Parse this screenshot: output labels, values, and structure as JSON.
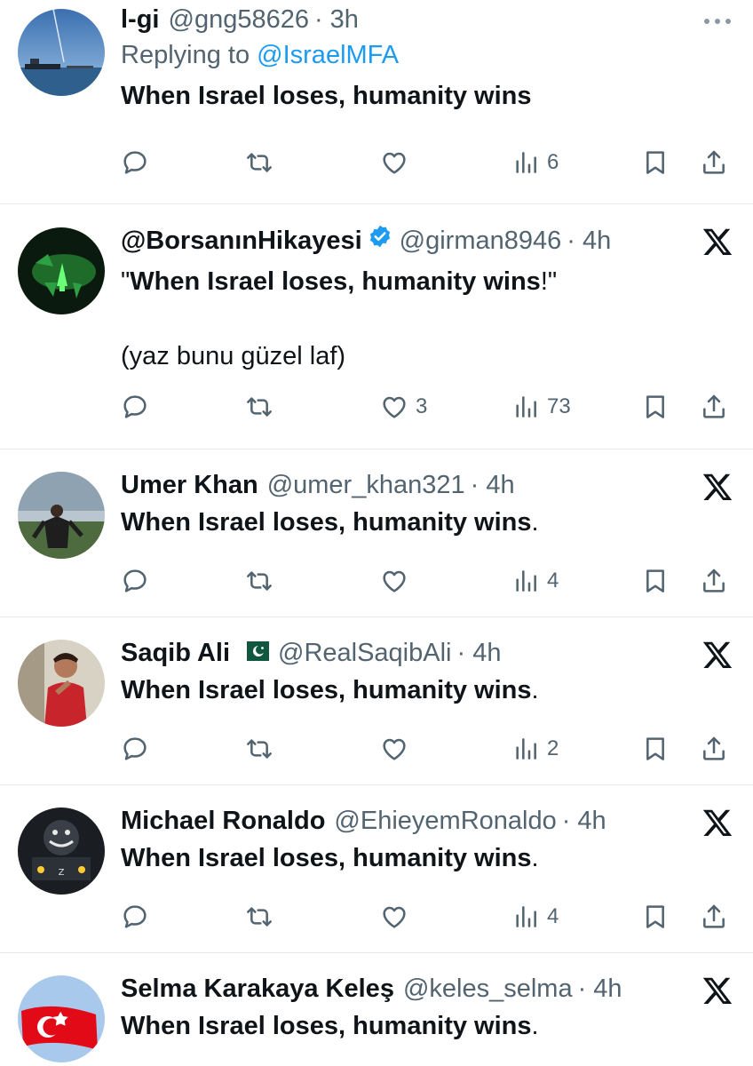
{
  "tweets": [
    {
      "name": "l-gi",
      "handle": "@gng58626",
      "time": "· 3h",
      "replying_prefix": "Replying to",
      "replying_to": "@IsraelMFA",
      "text": "When Israel loses, humanity wins",
      "top_icon": "more-icon",
      "reply_count": "",
      "retweet_count": "",
      "like_count": "",
      "views": "6"
    },
    {
      "name": "@BorsanınHikayesi",
      "handle": "@girman8946",
      "time": "· 4h",
      "verified": true,
      "text_bold": "When Israel loses, humanity wins",
      "text_tail": "!\"",
      "text_head": "\"",
      "text_extra": "(yaz bunu güzel laf)",
      "top_icon": "x-logo-icon",
      "like_count": "3",
      "views": "73"
    },
    {
      "name": "Umer Khan",
      "handle": "@umer_khan321",
      "time": "· 4h",
      "text_bold": "When Israel loses, humanity wins",
      "text_tail": ".",
      "top_icon": "x-logo-icon",
      "views": "4"
    },
    {
      "name": "Saqib Ali",
      "flag": "pakistan-flag",
      "handle": "@RealSaqibAli",
      "time": "· 4h",
      "text_bold": "When Israel loses, humanity wins",
      "text_tail": ".",
      "top_icon": "x-logo-icon",
      "views": "2"
    },
    {
      "name": "Michael Ronaldo",
      "handle": "@EhieyemRonaldo",
      "time": "· 4h",
      "text_bold": "When Israel loses, humanity wins",
      "text_tail": ".",
      "top_icon": "x-logo-icon",
      "views": "4"
    },
    {
      "name": "Selma Karakaya Keleş",
      "handle": "@keles_selma",
      "time": "· 4h",
      "text_bold": "When Israel loses, humanity wins",
      "text_tail": ".",
      "top_icon": "x-logo-icon"
    }
  ],
  "colors": {
    "text": "#0f1419",
    "secondary": "#536471",
    "accent": "#1d9bf0",
    "divider": "#e6e9ec"
  }
}
